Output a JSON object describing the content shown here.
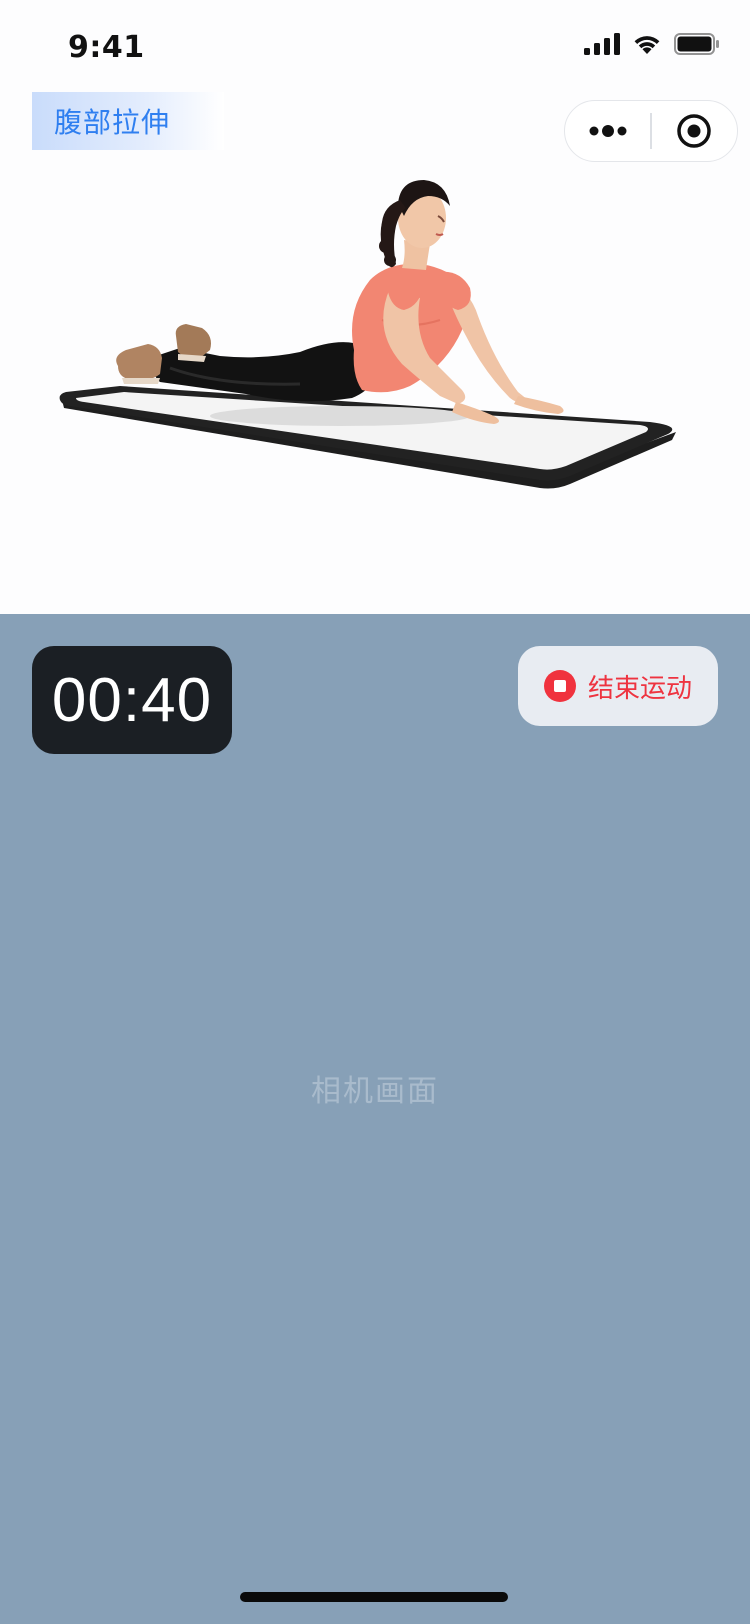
{
  "status_bar": {
    "time": "9:41"
  },
  "header": {
    "title": "腹部拉伸"
  },
  "capsule": {
    "more_icon": "more-dots-icon",
    "close_icon": "target-circle-icon"
  },
  "workout": {
    "timer": "00:40",
    "end_button_label": "结束运动",
    "end_icon": "stop-circle-icon"
  },
  "camera": {
    "placeholder": "相机画面"
  },
  "colors": {
    "accent_blue": "#2f7ff0",
    "camera_bg": "#87a0b7",
    "stop_red": "#f0323e",
    "timer_bg": "#1b1f24"
  }
}
